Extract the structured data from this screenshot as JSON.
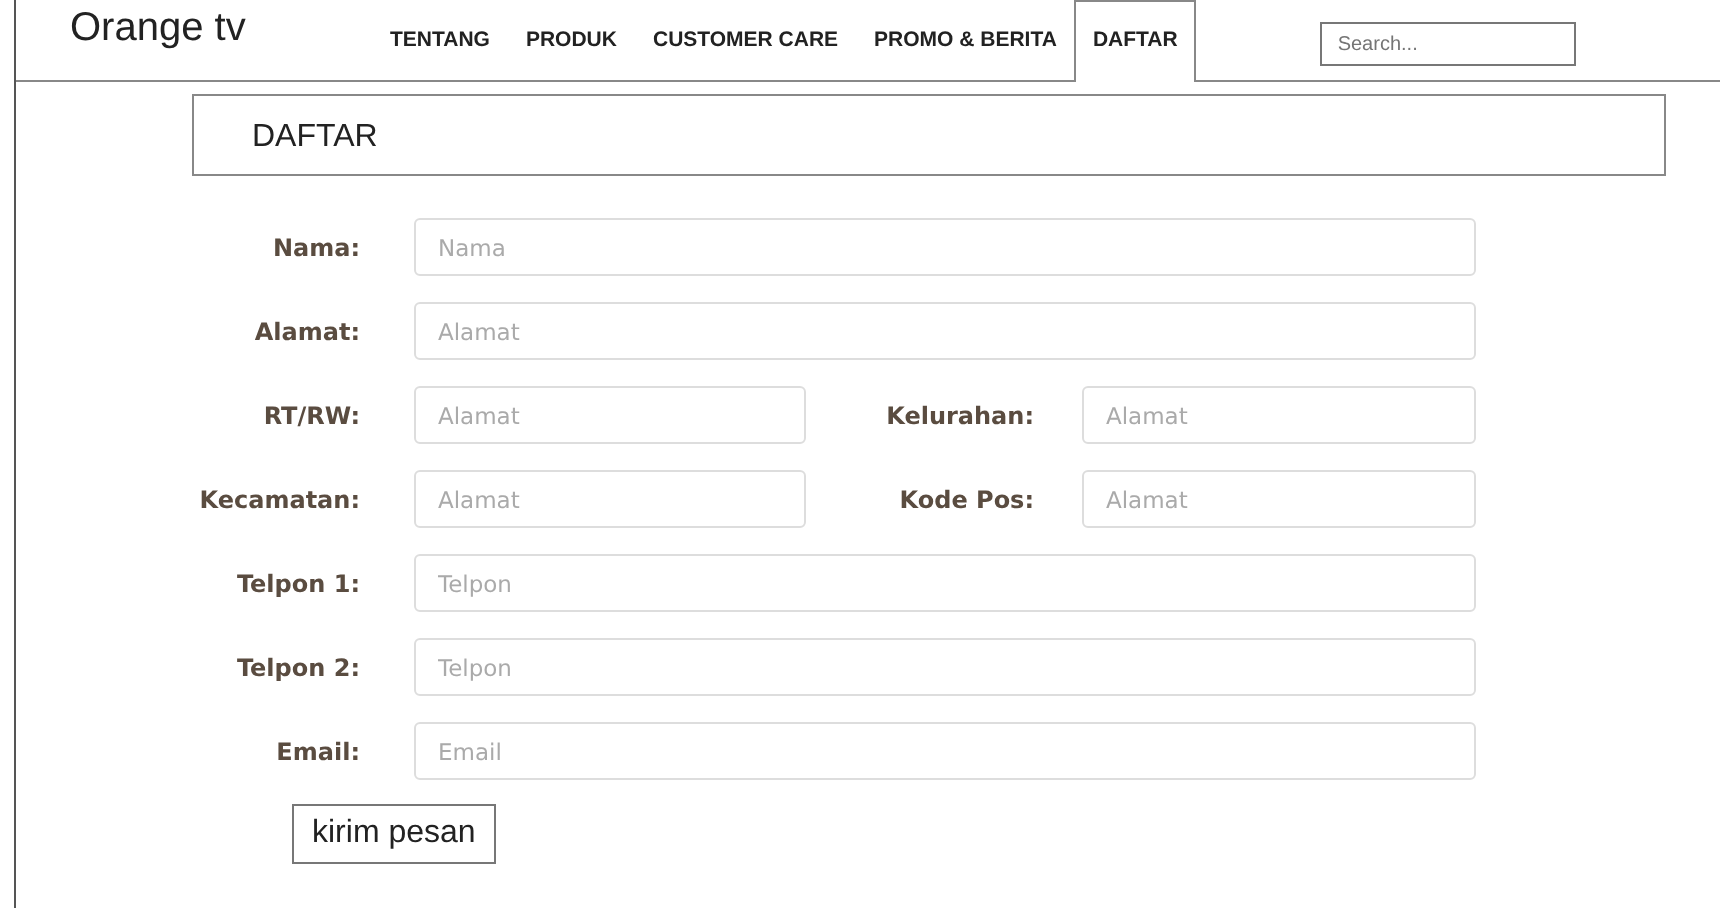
{
  "header": {
    "logo": "Orange tv",
    "nav": [
      {
        "label": "TENTANG",
        "selected": false
      },
      {
        "label": "PRODUK",
        "selected": false
      },
      {
        "label": "CUSTOMER CARE",
        "selected": false
      },
      {
        "label": "PROMO & BERITA",
        "selected": false
      },
      {
        "label": "DAFTAR",
        "selected": true
      }
    ],
    "search": {
      "placeholder": "Search..."
    }
  },
  "page_title": "DAFTAR",
  "form": {
    "rows": [
      {
        "fields": [
          {
            "label": "Nama:",
            "placeholder": "Nama"
          }
        ]
      },
      {
        "fields": [
          {
            "label": "Alamat:",
            "placeholder": "Alamat"
          }
        ]
      },
      {
        "fields": [
          {
            "label": "RT/RW:",
            "placeholder": "Alamat"
          },
          {
            "label": "Kelurahan:",
            "placeholder": "Alamat"
          }
        ]
      },
      {
        "fields": [
          {
            "label": "Kecamatan:",
            "placeholder": "Alamat"
          },
          {
            "label": "Kode Pos:",
            "placeholder": "Alamat"
          }
        ]
      },
      {
        "fields": [
          {
            "label": "Telpon 1:",
            "placeholder": "Telpon"
          }
        ]
      },
      {
        "fields": [
          {
            "label": "Telpon 2:",
            "placeholder": "Telpon"
          }
        ]
      },
      {
        "fields": [
          {
            "label": "Email:",
            "placeholder": "Email"
          }
        ]
      }
    ],
    "submit": "kirim pesan"
  }
}
